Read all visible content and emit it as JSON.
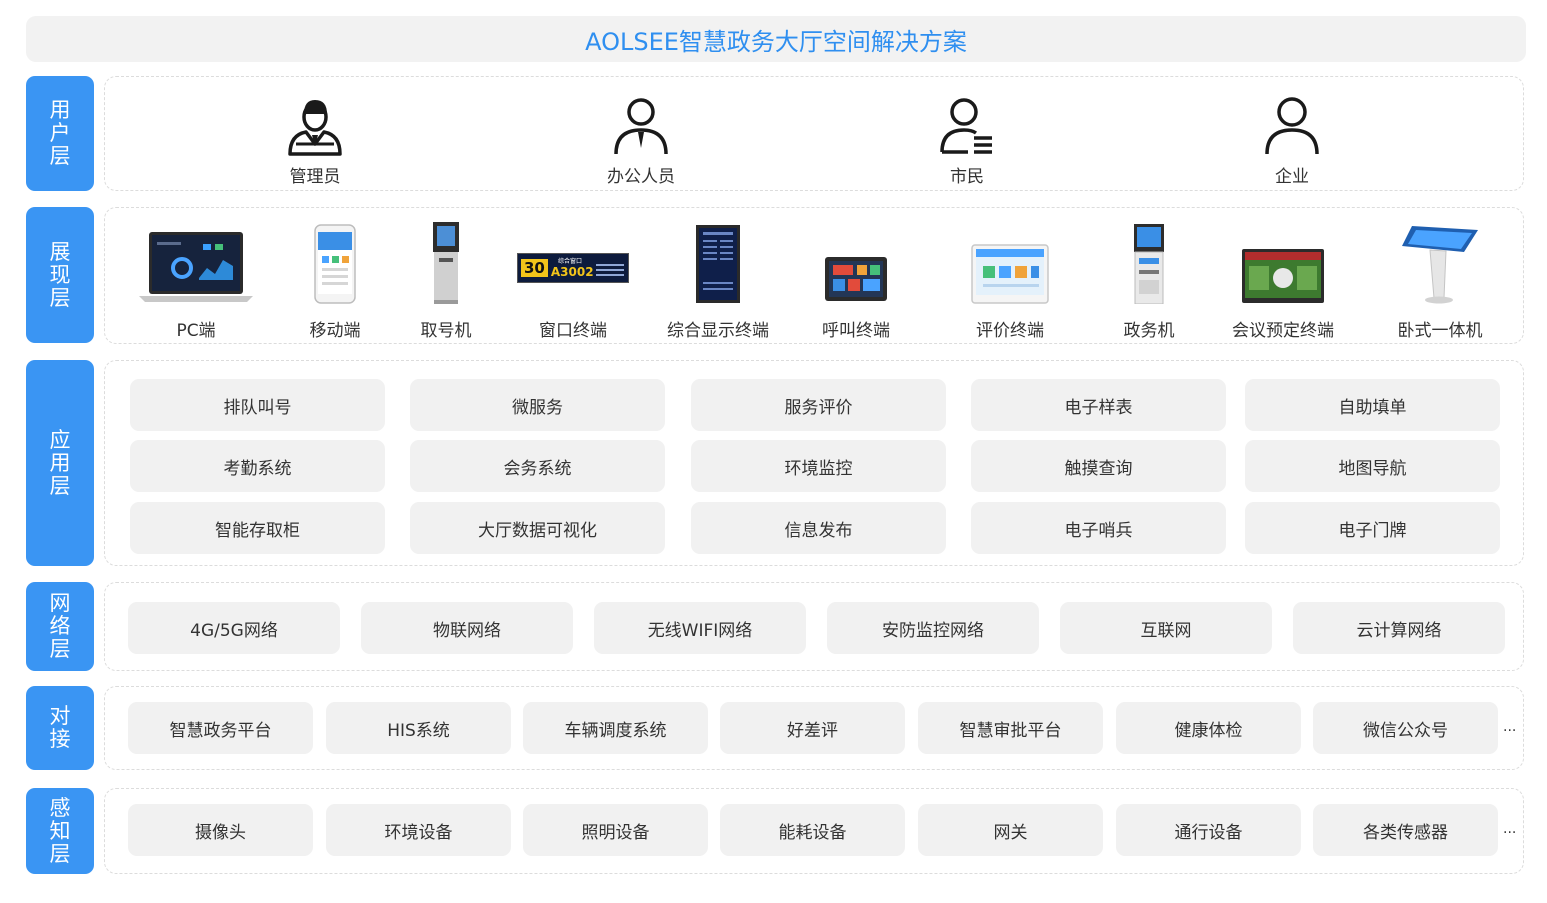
{
  "title": "AOLSEE智慧政务大厅空间解决方案",
  "layers": {
    "user": "用户层",
    "display": "展现层",
    "app": "应用层",
    "network": "网络层",
    "dock": "对接",
    "sense": "感知层"
  },
  "users": [
    {
      "label": "管理员",
      "icon": "manager-icon"
    },
    {
      "label": "办公人员",
      "icon": "office-staff-icon"
    },
    {
      "label": "市民",
      "icon": "citizen-icon"
    },
    {
      "label": "企业",
      "icon": "enterprise-icon"
    }
  ],
  "devices": [
    {
      "label": "PC端",
      "icon": "laptop-icon"
    },
    {
      "label": "移动端",
      "icon": "mobile-phone-icon"
    },
    {
      "label": "取号机",
      "icon": "ticket-kiosk-icon"
    },
    {
      "label": "窗口终端",
      "icon": "window-terminal-icon",
      "screen_number": "30",
      "screen_code": "A3002",
      "screen_window": "综合窗口"
    },
    {
      "label": "综合显示终端",
      "icon": "display-terminal-icon"
    },
    {
      "label": "呼叫终端",
      "icon": "call-terminal-icon"
    },
    {
      "label": "评价终端",
      "icon": "evaluation-terminal-icon"
    },
    {
      "label": "政务机",
      "icon": "gov-kiosk-icon"
    },
    {
      "label": "会议预定终端",
      "icon": "meeting-terminal-icon"
    },
    {
      "label": "卧式一体机",
      "icon": "horizontal-kiosk-icon"
    }
  ],
  "apps": [
    [
      "排队叫号",
      "微服务",
      "服务评价",
      "电子样表",
      "自助填单"
    ],
    [
      "考勤系统",
      "会务系统",
      "环境监控",
      "触摸查询",
      "地图导航"
    ],
    [
      "智能存取柜",
      "大厅数据可视化",
      "信息发布",
      "电子哨兵",
      "电子门牌"
    ]
  ],
  "networks": [
    "4G/5G网络",
    "物联网络",
    "无线WIFI网络",
    "安防监控网络",
    "互联网",
    "云计算网络"
  ],
  "docking": [
    "智慧政务平台",
    "HIS系统",
    "车辆调度系统",
    "好差评",
    "智慧审批平台",
    "健康体检",
    "微信公众号"
  ],
  "sensing": [
    "摄像头",
    "环境设备",
    "照明设备",
    "能耗设备",
    "网关",
    "通行设备",
    "各类传感器"
  ],
  "more": "...",
  "colors": {
    "accent": "#3a95f3",
    "title": "#2f8ff0",
    "pill": "#f1f1f1"
  }
}
